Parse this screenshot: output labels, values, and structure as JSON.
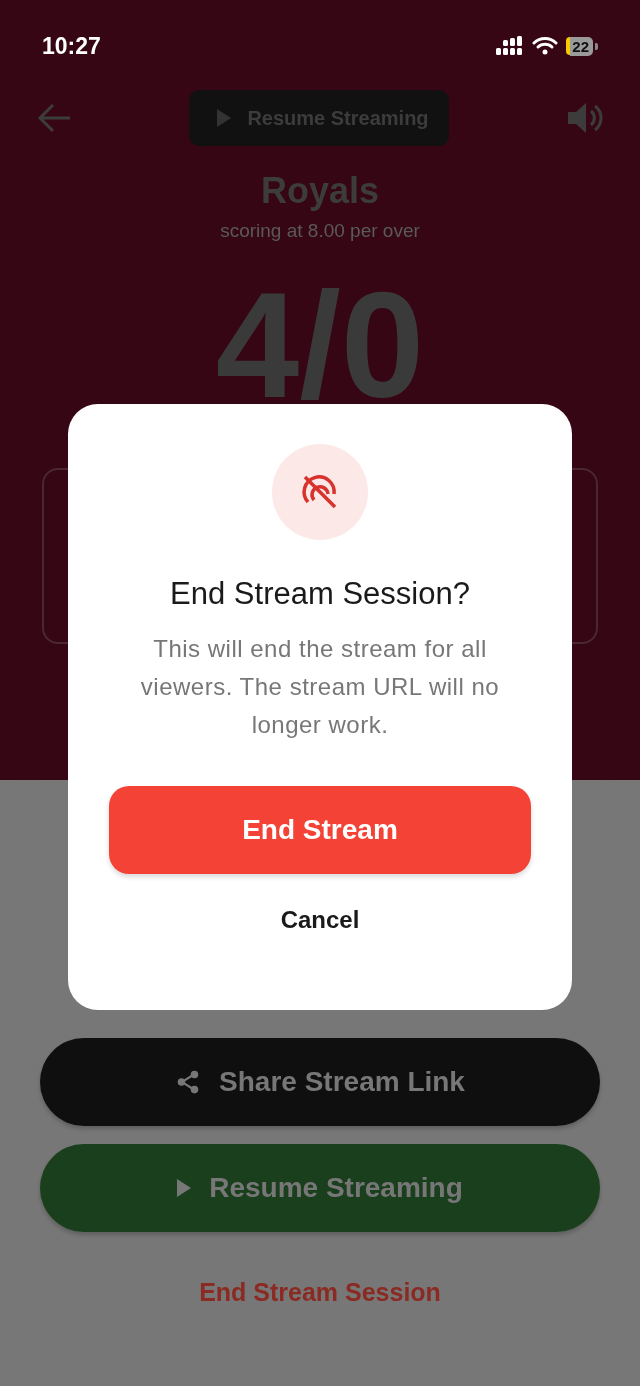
{
  "status_bar": {
    "time": "10:27",
    "battery": "22"
  },
  "top_bar": {
    "resume_button": "Resume Streaming"
  },
  "score": {
    "team": "Royals",
    "rate": "scoring at 8.00 per over",
    "score": "4/0"
  },
  "sheet": {
    "buttons": [
      {
        "kind": "share",
        "label": "Share Stream Link"
      },
      {
        "kind": "resume",
        "label": "Resume Streaming"
      }
    ],
    "end_link": "End Stream Session"
  },
  "dialog": {
    "title": "End Stream Session?",
    "message": "This will end the stream for all viewers. The stream URL will no longer work.",
    "confirm": "End Stream",
    "cancel": "Cancel"
  }
}
